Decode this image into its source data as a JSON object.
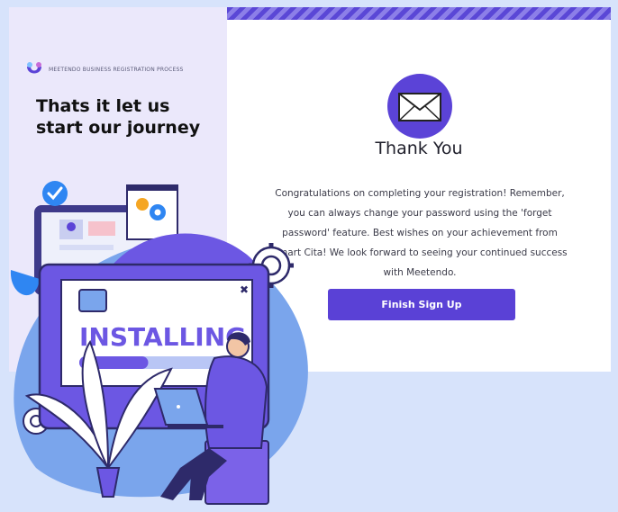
{
  "brand": {
    "logo_text": "MEETENDO BUSINESS REGISTRATION PROCESS",
    "accent_color": "#5a41d6"
  },
  "left": {
    "headline_line1": "Thats it let us",
    "headline_line2": "start our journey"
  },
  "card": {
    "title": "Thank You",
    "message": "Congratulations on completing your registration! Remember, you can always change your password using the 'forget password' feature. Best wishes on your achievement from Smart Cita! We look forward to seeing your continued success with Meetendo.",
    "button_label": "Finish Sign Up",
    "icon": "envelope-icon"
  },
  "illustration": {
    "screen_text": "INSTALLING",
    "progress_fraction": 0.45
  }
}
